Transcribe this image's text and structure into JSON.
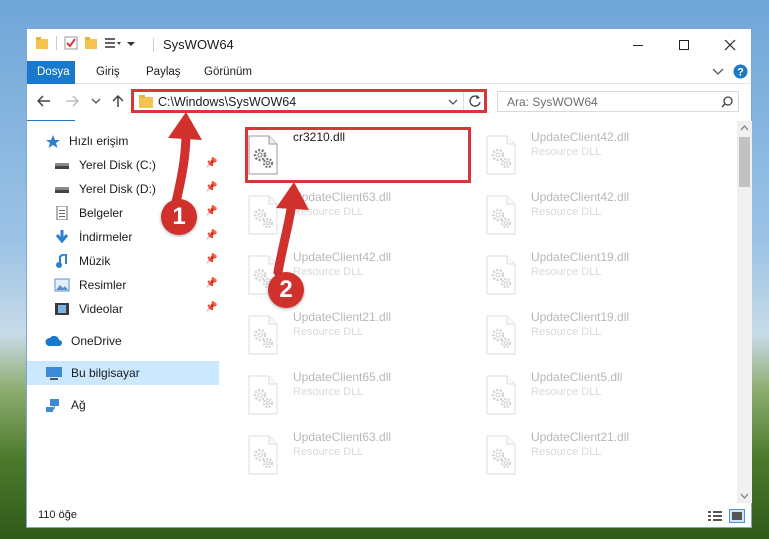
{
  "window": {
    "title": "SysWOW64"
  },
  "ribbon": {
    "tabs": [
      "Dosya",
      "Giriş",
      "Paylaş",
      "Görünüm"
    ]
  },
  "navigation": {
    "address": "C:\\Windows\\SysWOW64",
    "search_placeholder": "Ara: SysWOW64"
  },
  "sidebar": {
    "items": [
      {
        "label": "Hızlı erişim",
        "icon": "star-icon"
      },
      {
        "label": "Yerel Disk (C:)",
        "icon": "drive-icon",
        "pinned": true
      },
      {
        "label": "Yerel Disk (D:)",
        "icon": "drive-icon",
        "pinned": true
      },
      {
        "label": "Belgeler",
        "icon": "documents-icon",
        "pinned": true
      },
      {
        "label": "İndirmeler",
        "icon": "downloads-icon",
        "pinned": true
      },
      {
        "label": "Müzik",
        "icon": "music-icon",
        "pinned": true
      },
      {
        "label": "Resimler",
        "icon": "pictures-icon",
        "pinned": true
      },
      {
        "label": "Videolar",
        "icon": "videos-icon",
        "pinned": true
      },
      {
        "label": "OneDrive",
        "icon": "cloud-icon"
      },
      {
        "label": "Bu bilgisayar",
        "icon": "computer-icon",
        "selected": true
      },
      {
        "label": "Ağ",
        "icon": "network-icon"
      }
    ]
  },
  "files": [
    {
      "name": "cr3210.dll",
      "type": "",
      "faded": false
    },
    {
      "name": "UpdateClient42.dll",
      "type": "Resource DLL",
      "faded": true
    },
    {
      "name": "UpdateClient63.dll",
      "type": "Resource DLL",
      "faded": true
    },
    {
      "name": "UpdateClient42.dll",
      "type": "Resource DLL",
      "faded": true
    },
    {
      "name": "UpdateClient42.dll",
      "type": "Resource DLL",
      "faded": true
    },
    {
      "name": "UpdateClient19.dll",
      "type": "Resource DLL",
      "faded": true
    },
    {
      "name": "UpdateClient21.dll",
      "type": "Resource DLL",
      "faded": true
    },
    {
      "name": "UpdateClient19.dll",
      "type": "Resource DLL",
      "faded": true
    },
    {
      "name": "UpdateClient65.dll",
      "type": "Resource DLL",
      "faded": true
    },
    {
      "name": "UpdateClient5.dll",
      "type": "Resource DLL",
      "faded": true
    },
    {
      "name": "UpdateClient63.dll",
      "type": "Resource DLL",
      "faded": true
    },
    {
      "name": "UpdateClient21.dll",
      "type": "Resource DLL",
      "faded": true
    }
  ],
  "status": {
    "item_count": "110 öğe"
  },
  "annotations": {
    "step1": "1",
    "step2": "2"
  },
  "colors": {
    "accent": "#1979ca",
    "highlight": "#d9363a",
    "selection": "#cce8ff"
  }
}
